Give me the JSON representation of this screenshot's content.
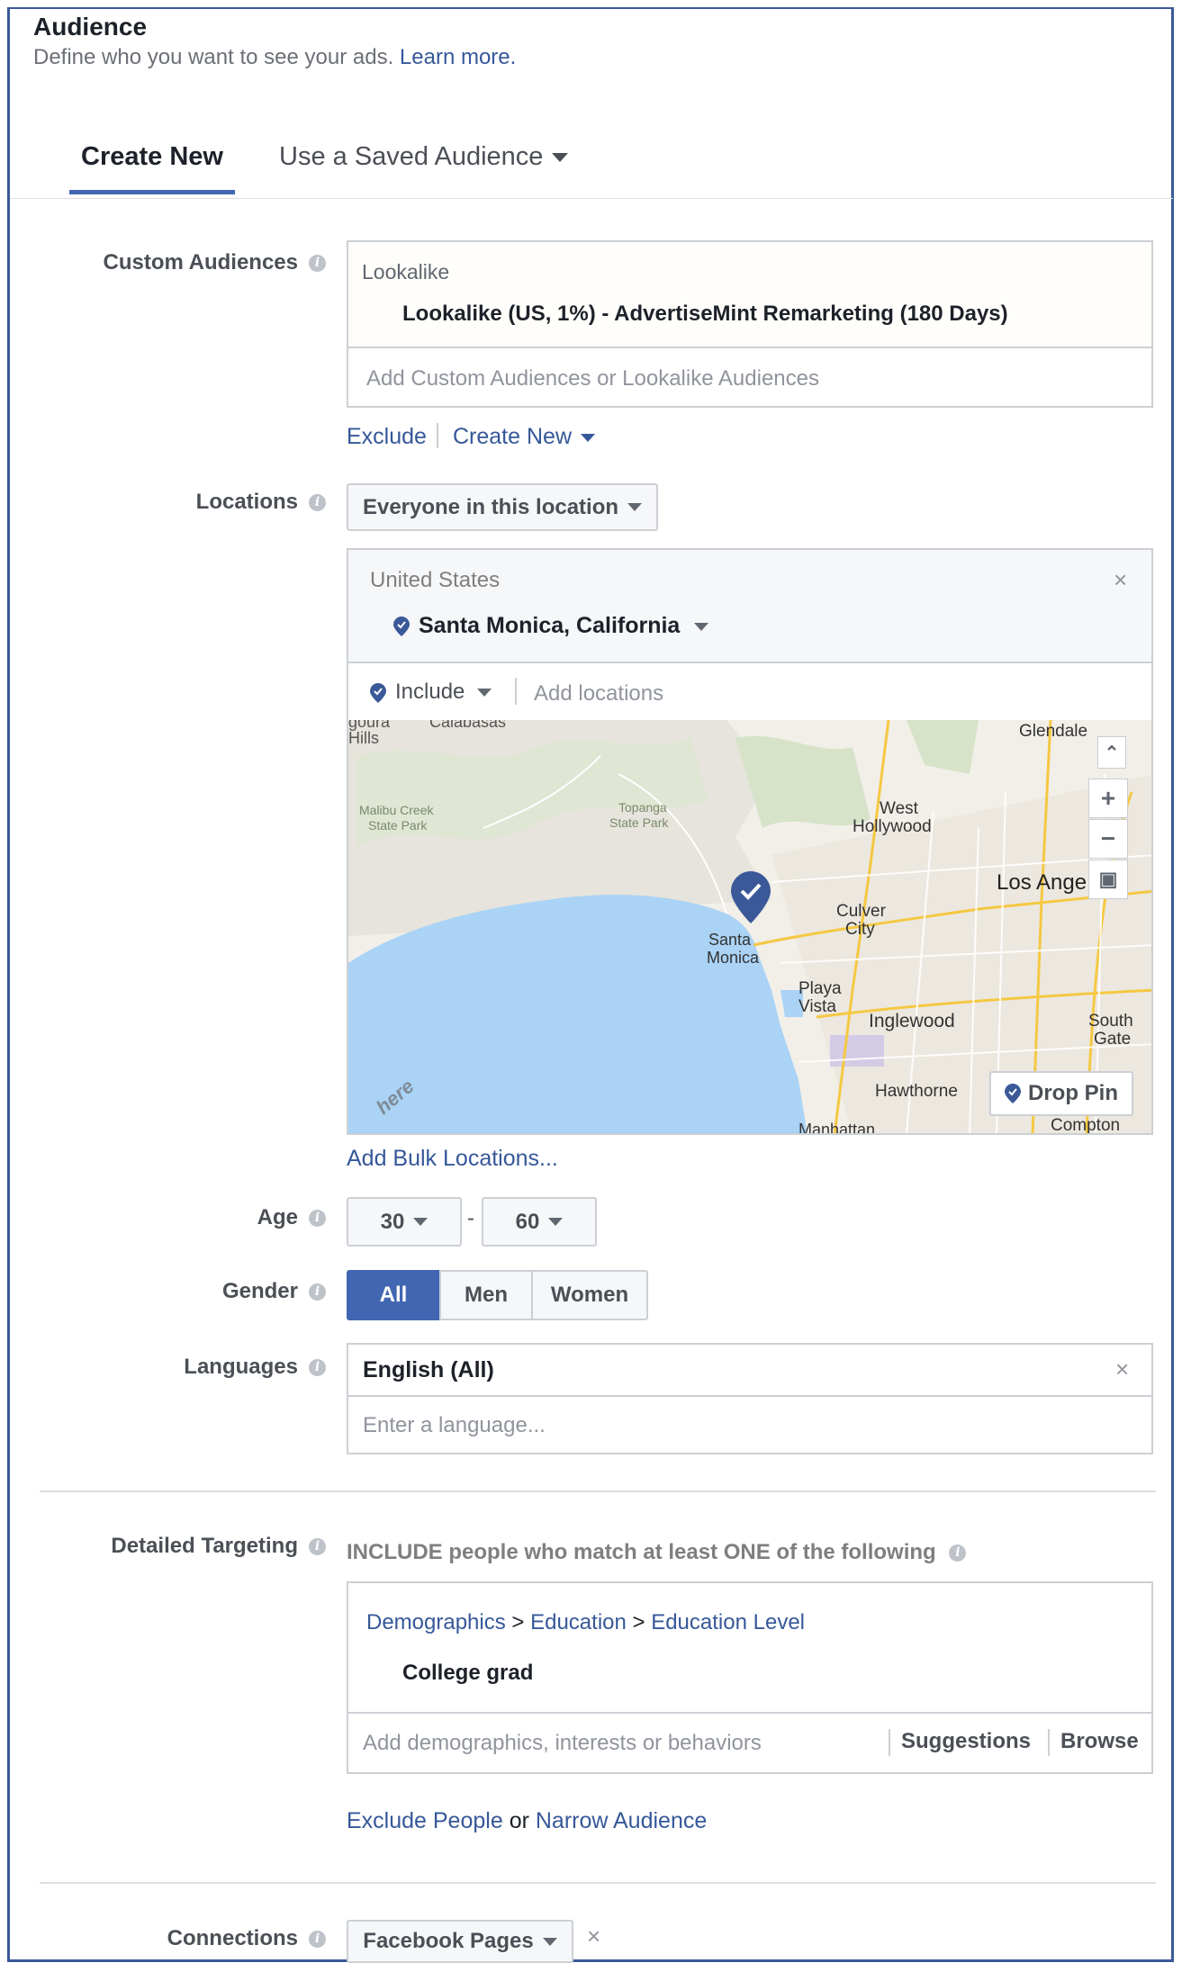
{
  "header": {
    "title": "Audience",
    "subtitle": "Define who you want to see your ads.",
    "learn_more": "Learn more."
  },
  "tabs": {
    "create_new": "Create New",
    "saved": "Use a Saved Audience"
  },
  "custom_audiences": {
    "label": "Custom Audiences",
    "group": "Lookalike",
    "selected": "Lookalike (US, 1%) - AdvertiseMint Remarketing (180 Days)",
    "placeholder": "Add Custom Audiences or Lookalike Audiences",
    "exclude": "Exclude",
    "create_new": "Create New"
  },
  "locations": {
    "label": "Locations",
    "dropdown": "Everyone in this location",
    "country": "United States",
    "city": "Santa Monica, California",
    "include": "Include",
    "placeholder": "Add locations",
    "add_bulk": "Add Bulk Locations...",
    "map": {
      "places": [
        "Calabasas",
        "Glendale",
        "Malibu Creek",
        "State Park",
        "Topanga",
        "State Park",
        "West",
        "Hollywood",
        "Los Ange",
        "Santa",
        "Monica",
        "Culver",
        "City",
        "Playa",
        "Vista",
        "Inglewood",
        "South",
        "Gate",
        "Hawthorne",
        "Compton",
        "Manhattan",
        "goura",
        "Hills"
      ],
      "drop_pin": "Drop Pin",
      "watermark": "here",
      "zoom_in": "+",
      "zoom_out": "−"
    }
  },
  "age": {
    "label": "Age",
    "min": "30",
    "dash": "-",
    "max": "60"
  },
  "gender": {
    "label": "Gender",
    "options": [
      "All",
      "Men",
      "Women"
    ],
    "selected": "All"
  },
  "languages": {
    "label": "Languages",
    "selected": "English (All)",
    "placeholder": "Enter a language..."
  },
  "detailed_targeting": {
    "label": "Detailed Targeting",
    "heading": "INCLUDE people who match at least ONE of the following",
    "crumbs": [
      "Demographics",
      "Education",
      "Education Level"
    ],
    "crumb_sep": ">",
    "selected": "College grad",
    "placeholder": "Add demographics, interests or behaviors",
    "suggestions": "Suggestions",
    "browse": "Browse",
    "exclude": "Exclude People",
    "or": "or",
    "narrow": "Narrow Audience"
  },
  "connections": {
    "label": "Connections",
    "dropdown": "Facebook Pages"
  },
  "colors": {
    "accent": "#4267b2",
    "link": "#365899",
    "border": "#ccd0d5",
    "water": "#aad3f5",
    "land": "#f2efe9"
  }
}
